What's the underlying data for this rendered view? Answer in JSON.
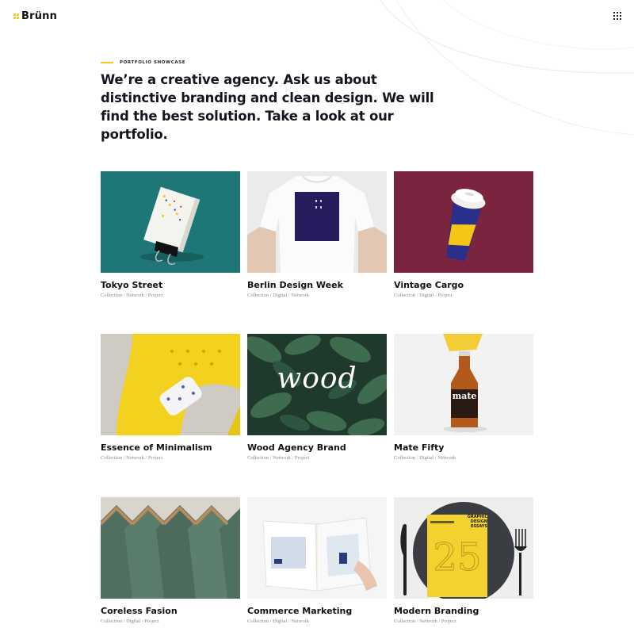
{
  "header": {
    "brand": "Brünn",
    "logo_icon": "four-dot-logo-mark",
    "menu_icon": "grid-menu-icon",
    "accent_color": "#f5c518"
  },
  "hero": {
    "eyebrow": "Portfolio Showcase",
    "headline": "We’re a creative agency. Ask us about distinctive branding and clean design. We will find the best solution. Take a look at our portfolio."
  },
  "portfolio": [
    {
      "title": "Tokyo Street",
      "tags": "Collection / Network / Project",
      "image": "business-card-clip"
    },
    {
      "title": "Berlin Design Week",
      "tags": "Collection / Digital / Network",
      "image": "tshirt-print"
    },
    {
      "title": "Vintage Cargo",
      "tags": "Collection / Digital / Project",
      "image": "coffee-cup"
    },
    {
      "title": "Essence of Minimalism",
      "tags": "Collection / Network / Project",
      "image": "yellow-sofa"
    },
    {
      "title": "Wood Agency Brand",
      "tags": "Collection / Network / Project",
      "image": "wood-leaves",
      "image_text": "wood"
    },
    {
      "title": "Mate Fifty",
      "tags": "Collection / Digital / Network",
      "image": "mate-bottle",
      "image_text": "mate"
    },
    {
      "title": "Coreless Fasion",
      "tags": "Collection / Digital / Project",
      "image": "hangers-shirts"
    },
    {
      "title": "Commerce Marketing",
      "tags": "Collection / Digital / Network",
      "image": "open-magazine"
    },
    {
      "title": "Modern Branding",
      "tags": "Collection / Network / Project",
      "image": "book-on-plate",
      "image_text": "GRAPHIC DESIGN ESSAYS"
    }
  ]
}
